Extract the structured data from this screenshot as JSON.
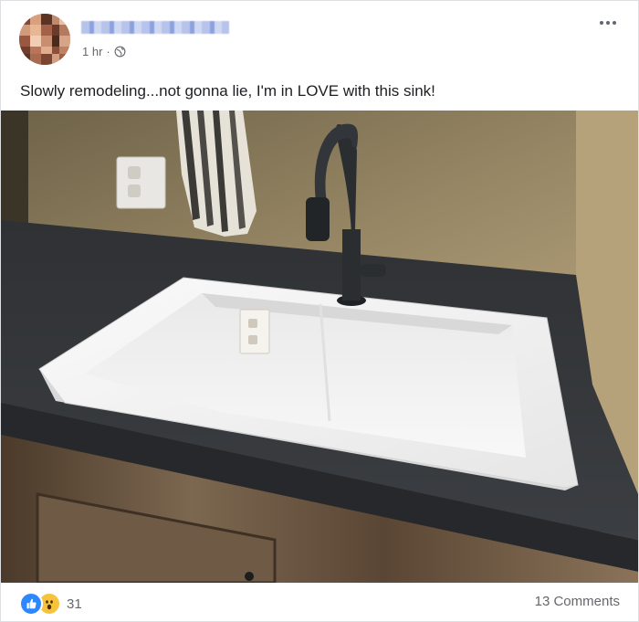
{
  "post": {
    "author_name": "",
    "timestamp": "1 hr",
    "separator": "·",
    "audience_icon": "globe-icon",
    "more_icon": "more-options-icon",
    "text": "Slowly remodeling...not gonna lie, I'm in LOVE with this sink!"
  },
  "photo": {
    "description_icon": "photo-of-white-sink"
  },
  "footer": {
    "reaction_icons": [
      "like-icon",
      "wow-icon"
    ],
    "reaction_count": "31",
    "comments_label": "13 Comments"
  },
  "colors": {
    "accent_blue": "#2d88ff",
    "wow_yellow": "#f7c33c",
    "meta_gray": "#65676b"
  }
}
